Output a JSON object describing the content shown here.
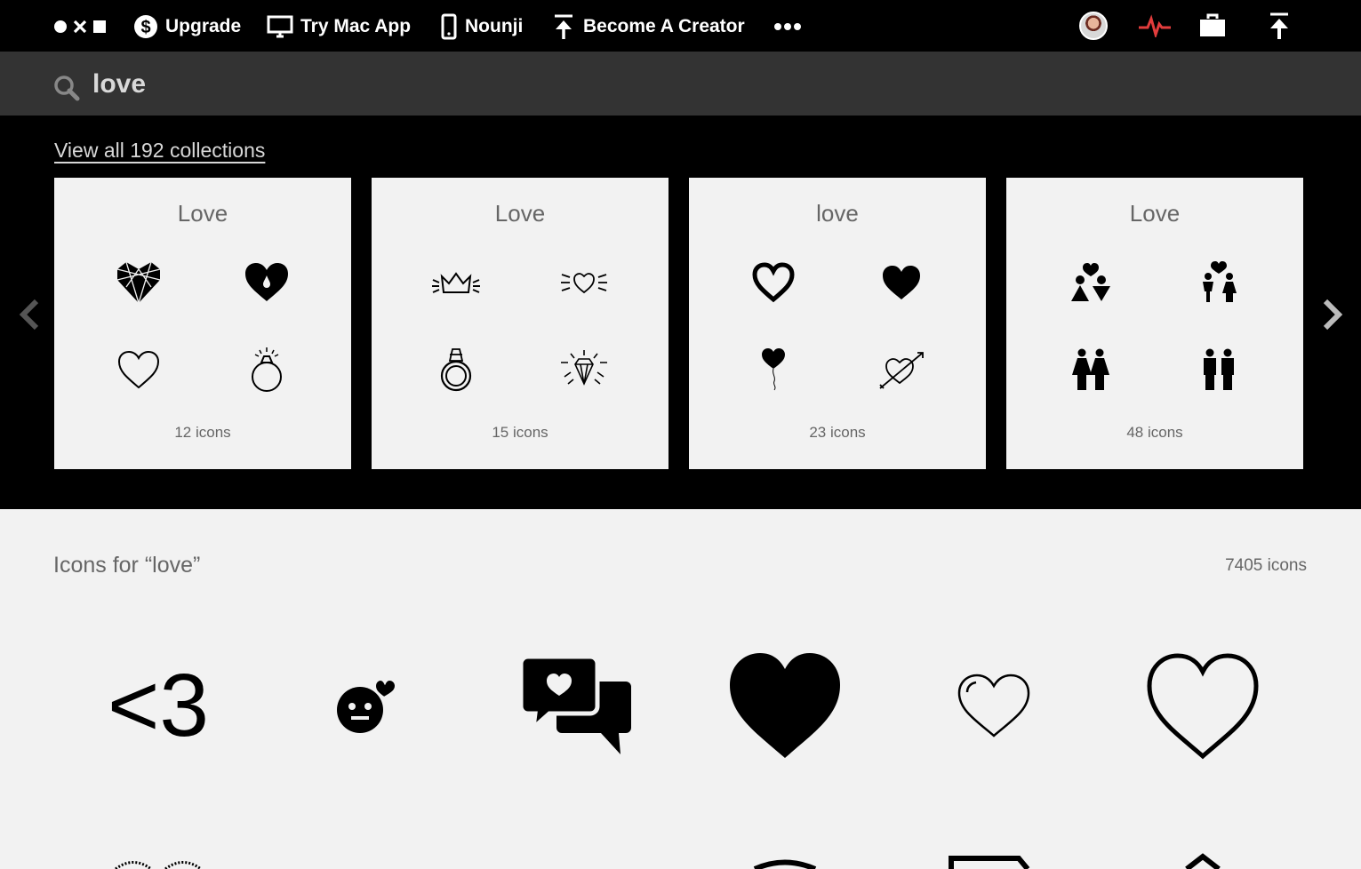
{
  "nav": {
    "logo_icon": "noun-project-logo",
    "items": [
      {
        "label": "Upgrade",
        "icon": "dollar-circle-icon"
      },
      {
        "label": "Try Mac App",
        "icon": "monitor-icon"
      },
      {
        "label": "Nounji",
        "icon": "phone-icon"
      },
      {
        "label": "Become A Creator",
        "icon": "upload-icon"
      }
    ],
    "more_icon": "more-dots-icon",
    "right_icons": [
      "avatar",
      "activity-icon",
      "briefcase-icon",
      "upload-icon"
    ]
  },
  "search": {
    "value": "love",
    "icon": "search-icon"
  },
  "collections": {
    "view_all_label": "View all 192 collections",
    "items": [
      {
        "title": "Love",
        "count": "12 icons",
        "icons": [
          "geometric-heart-icon",
          "heart-drop-icon",
          "heart-outline-icon",
          "ring-icon"
        ]
      },
      {
        "title": "Love",
        "count": "15 icons",
        "icons": [
          "crown-icon",
          "sparkle-heart-icon",
          "diamond-ring-icon",
          "diamond-icon"
        ]
      },
      {
        "title": "love",
        "count": "23 icons",
        "icons": [
          "bold-heart-outline-icon",
          "solid-heart-icon",
          "heart-balloon-icon",
          "heart-arrow-icon"
        ]
      },
      {
        "title": "Love",
        "count": "48 icons",
        "icons": [
          "couple-heart-icon",
          "man-woman-heart-icon",
          "women-couple-icon",
          "men-couple-icon"
        ]
      }
    ]
  },
  "results": {
    "title": "Icons for “love”",
    "count": "7405 icons",
    "row1_icons": [
      "less-than-three-icon",
      "love-face-icon",
      "chat-heart-icon",
      "solid-heart-icon",
      "thin-heart-outline-icon",
      "heart-outline-icon"
    ],
    "row1_text": "<3"
  },
  "colors": {
    "topbar": "#000000",
    "searchbar": "#333333",
    "accent": "#e23c3c",
    "background": "#f2f2f2"
  }
}
